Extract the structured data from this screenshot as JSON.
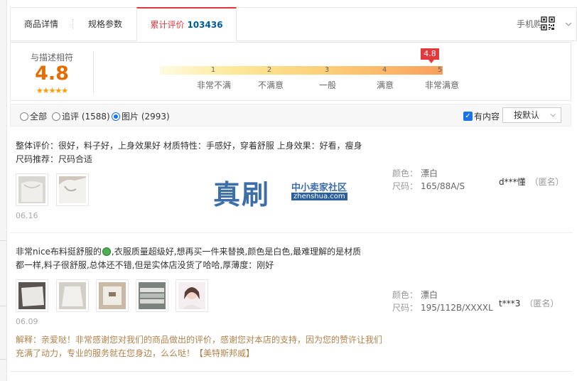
{
  "tabs": {
    "detail": "商品详情",
    "spec": "规格参数",
    "review": "累计评价",
    "review_count": "103436",
    "mobile_buy": "手机购买"
  },
  "summary": {
    "label": "与描述相符",
    "score": "4.8",
    "stars": "★★★★★",
    "marker": "4.8",
    "scale": [
      {
        "num": "1",
        "label": "非常不满"
      },
      {
        "num": "2",
        "label": "不满意"
      },
      {
        "num": "3",
        "label": "一般"
      },
      {
        "num": "4",
        "label": "满意"
      },
      {
        "num": "5",
        "label": "非常满意"
      }
    ]
  },
  "filter": {
    "all": "全部",
    "followup": "追评 (1588)",
    "pictures": "图片 (2993)",
    "has_content": "有内容",
    "sort": "按默认",
    "selected": "pictures"
  },
  "reviews": [
    {
      "text": "整体评价：很好，料子好，上身效果好 材质特性：手感好，穿着舒服 上身效果：好看，瘦身 尺码推荐：尺码合适",
      "date": "06.16",
      "color_label": "颜色：",
      "color": "漂白",
      "size_label": "尺码：",
      "size": "165/88A/S",
      "user": "d***懂",
      "anon": "（匿名）"
    },
    {
      "text_a": "非常nice布料挺舒服的",
      "text_b": ",衣服质量超级好,想再买一件来替换,颜色是白色,最难理解的是材质都一样,料子很舒服,总体还不错,但是实体店没货了哈哈,厚薄度：刚好",
      "date": "06.09",
      "color_label": "颜色：",
      "color": "漂白",
      "size_label": "尺码：",
      "size": "195/112B/XXXXL",
      "user": "t***3",
      "anon": "（匿名）",
      "reply": "解释：亲爱哒！非常感谢您对我们的商品做出的评价，感谢您对本店的支持，因为您的赞许让我们充满了动力，专业的服务就在您身边，么么哒！【美特斯邦威】"
    }
  ],
  "watermark": {
    "big": "真刷",
    "small": "中小卖家社区",
    "url": "zhenshua.com"
  }
}
